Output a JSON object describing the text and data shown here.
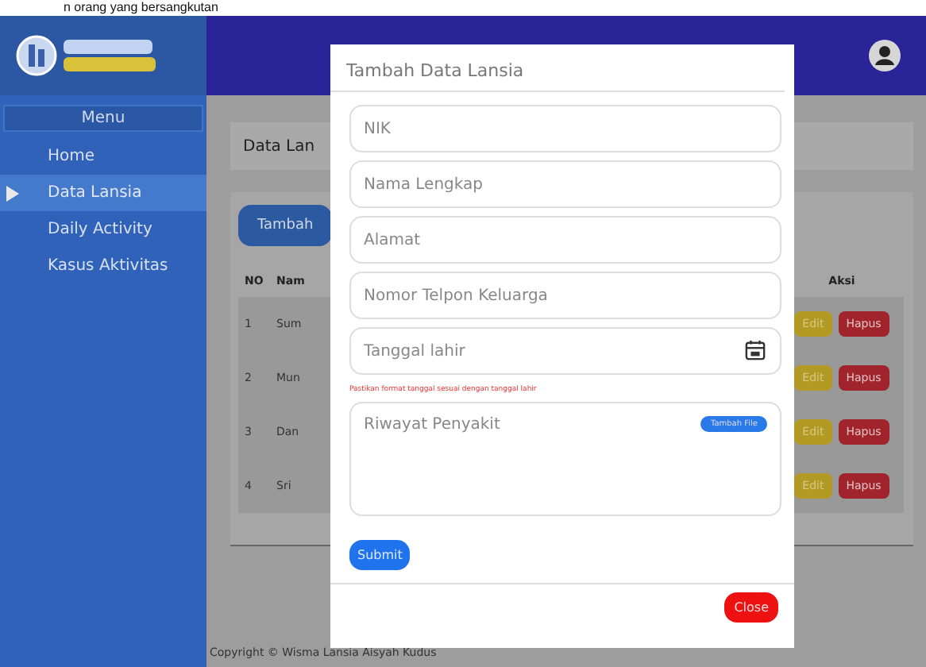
{
  "caption": "n orang yang bersangkutan",
  "sidebar": {
    "menu_title": "Menu",
    "items": [
      {
        "label": "Home",
        "selected": false
      },
      {
        "label": "Data Lansia",
        "selected": true
      },
      {
        "label": "Daily Activity",
        "selected": false
      },
      {
        "label": "Kasus Aktivitas",
        "selected": false
      }
    ]
  },
  "page": {
    "heading": "Data Lan",
    "add_button": "Tambah",
    "table": {
      "columns": [
        "NO",
        "Nam",
        "Aksi"
      ],
      "rows": [
        {
          "no": "1",
          "name": "Sum",
          "edit": "Edit",
          "delete": "Hapus"
        },
        {
          "no": "2",
          "name": "Mun",
          "edit": "Edit",
          "delete": "Hapus"
        },
        {
          "no": "3",
          "name": "Dan",
          "edit": "Edit",
          "delete": "Hapus"
        },
        {
          "no": "4",
          "name": "Sri",
          "edit": "Edit",
          "delete": "Hapus"
        }
      ]
    }
  },
  "footer": "Copyright © Wisma Lansia Aisyah Kudus",
  "modal": {
    "title": "Tambah Data Lansia",
    "fields": [
      {
        "kind": "text",
        "placeholder": "NIK"
      },
      {
        "kind": "text",
        "placeholder": "Nama Lengkap"
      },
      {
        "kind": "text",
        "placeholder": "Alamat"
      },
      {
        "kind": "text",
        "placeholder": "Nomor Telpon Keluarga"
      },
      {
        "kind": "date",
        "placeholder": "Tanggal lahir",
        "error": "Pastikan format tanggal sesuai dengan tanggal lahir"
      },
      {
        "kind": "textarea",
        "placeholder": "Riwayat Penyakit",
        "badge": "Tambah File"
      }
    ],
    "submit": "Submit",
    "close": "Close"
  }
}
